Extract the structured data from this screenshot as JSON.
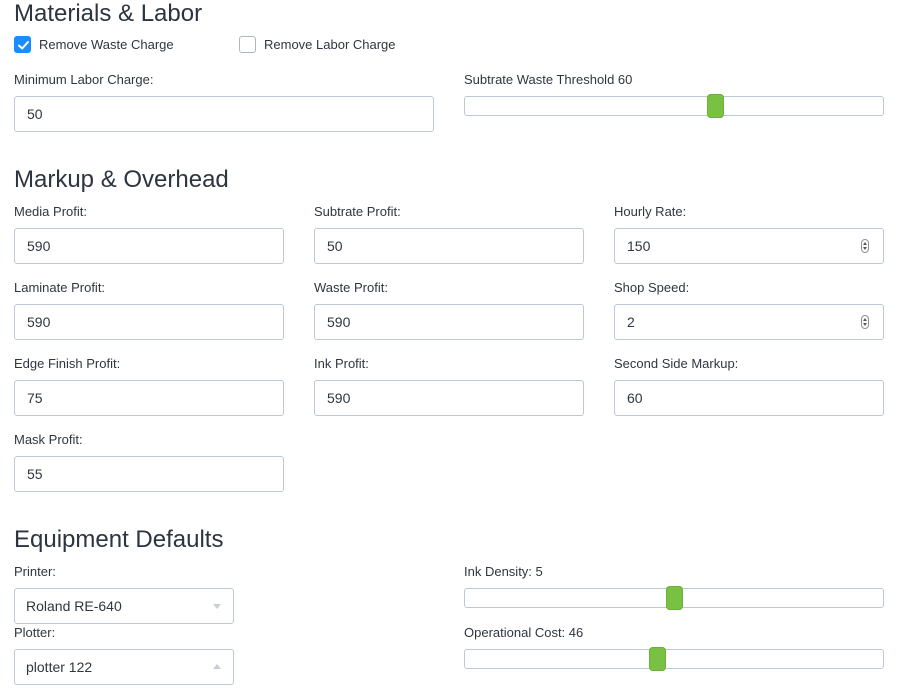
{
  "materials_labor": {
    "title": "Materials & Labor",
    "remove_waste": {
      "label": "Remove Waste Charge",
      "checked": true
    },
    "remove_labor": {
      "label": "Remove Labor Charge",
      "checked": false
    },
    "min_labor": {
      "label": "Minimum Labor Charge:",
      "value": "50"
    },
    "waste_threshold": {
      "label": "Subtrate Waste Threshold 60",
      "value": 60
    }
  },
  "markup_overhead": {
    "title": "Markup & Overhead",
    "fields": [
      {
        "label": "Media Profit:",
        "value": "590"
      },
      {
        "label": "Subtrate Profit:",
        "value": "50"
      },
      {
        "label": "Hourly Rate:",
        "value": "150",
        "spinner": true
      },
      {
        "label": "Laminate Profit:",
        "value": "590"
      },
      {
        "label": "Waste Profit:",
        "value": "590"
      },
      {
        "label": "Shop Speed:",
        "value": "2",
        "spinner": true
      },
      {
        "label": "Edge Finish Profit:",
        "value": "75"
      },
      {
        "label": "Ink Profit:",
        "value": "590"
      },
      {
        "label": "Second Side Markup:",
        "value": "60"
      },
      {
        "label": "Mask Profit:",
        "value": "55"
      }
    ]
  },
  "equipment_defaults": {
    "title": "Equipment Defaults",
    "printer": {
      "label": "Printer:",
      "value": "Roland RE-640"
    },
    "plotter": {
      "label": "Plotter:",
      "value": "plotter 122"
    },
    "ink_density": {
      "label": "Ink Density: 5",
      "value": 5
    },
    "operational_cost": {
      "label": "Operational Cost: 46",
      "value": 46
    }
  },
  "colors": {
    "accent_blue": "#1a8cff",
    "slider_green": "#79c143",
    "border": "#bcc8d6"
  }
}
